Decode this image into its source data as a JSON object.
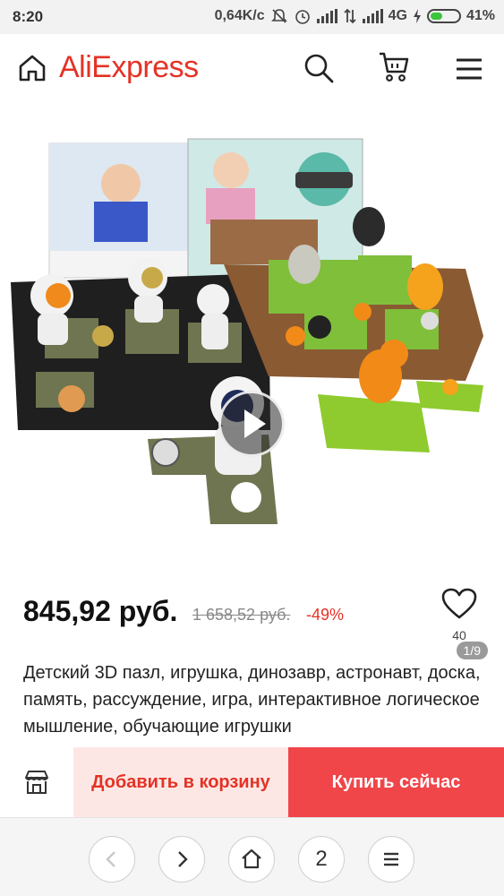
{
  "status": {
    "time": "8:20",
    "speed": "0,64K/c",
    "network": "4G",
    "battery": "41%"
  },
  "header": {
    "logo": "AliExpress",
    "icons": [
      "home-icon",
      "search-icon",
      "cart-icon",
      "menu-icon"
    ]
  },
  "gallery": {
    "counter": "1/9"
  },
  "product": {
    "price": "845,92 руб.",
    "old_price": "1 658,52 руб.",
    "discount": "-49%",
    "wishlist_count": "40",
    "title": "Детский 3D пазл, игрушка, динозавр, астронавт, доска, память, рассуждение, игра, интерактивное логическое мышление, обучающие игрушки"
  },
  "actions": {
    "add_to_cart": "Добавить в корзину",
    "buy_now": "Купить сейчас"
  },
  "browser_nav": {
    "tabs_count": "2"
  },
  "colors": {
    "brand": "#e43225",
    "buy": "#f0464a",
    "cart_bg": "#fde7e5"
  }
}
